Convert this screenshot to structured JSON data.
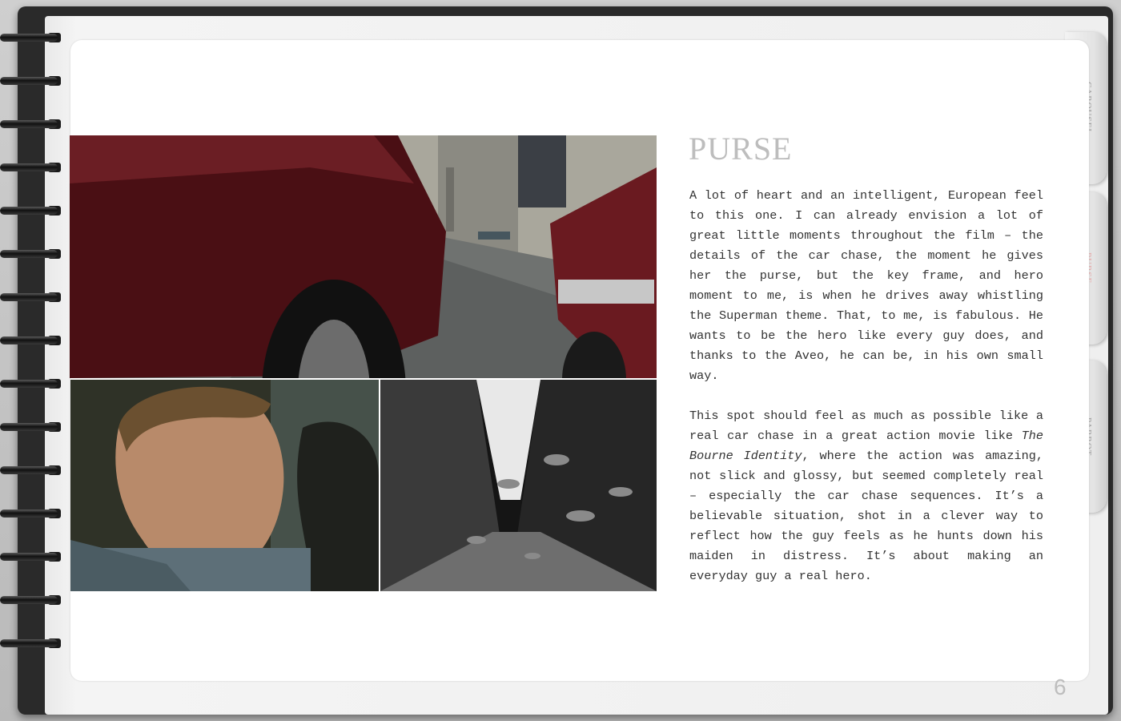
{
  "tabs": [
    {
      "label": "CAROUSEL",
      "active": false
    },
    {
      "label": "PURSE",
      "active": true
    },
    {
      "label": "PARROT",
      "active": false
    }
  ],
  "article": {
    "title": "PURSE",
    "paragraph1": "A lot of heart and an intelligent, European feel to this one.  I can already envision a lot of great little moments throughout the film – the details of the car chase, the moment he gives her the purse, but the key frame, and hero moment to me, is when he drives away whistling the Superman theme.  That, to me, is fabulous.  He wants to be the hero like every guy does, and thanks to the Aveo, he can be, in his own small way.",
    "paragraph2_before": "This spot should feel as much as possible like a real car chase in a great action movie like ",
    "paragraph2_italic": "The Bourne Identity",
    "paragraph2_after": ", where the action was amazing, not slick and glossy, but seemed completely real – especially the car chase sequences. It’s a believable situation, shot in a clever way to reflect how the guy feels as he hunts down his maiden in distress.  It’s about making an everyday guy a real hero."
  },
  "page_number": "6",
  "colors": {
    "title": "#bdbdbd",
    "active_tab_label": "#e6a6a6",
    "inactive_tab_label": "#9a9a9a"
  }
}
